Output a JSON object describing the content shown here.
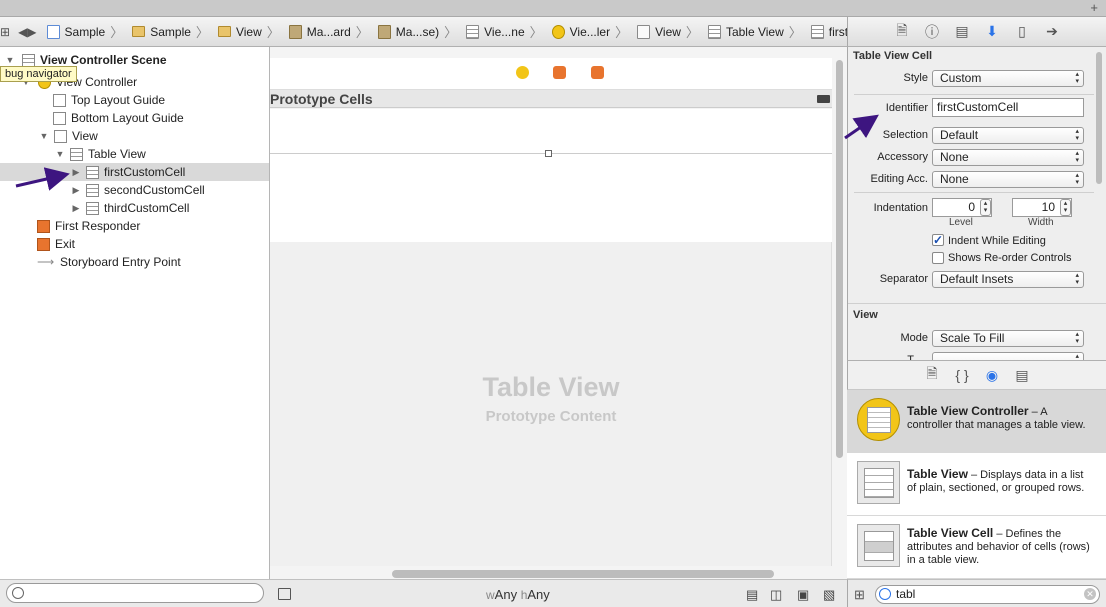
{
  "toolbar": {
    "plus": "+"
  },
  "jumpbar": {
    "grid": "⊞",
    "back": "◀",
    "forward": "▶",
    "crumbs": [
      "Sample",
      "Sample",
      "View",
      "Ma...ard",
      "Ma...se)",
      "Vie...ne",
      "Vie...ler",
      "View",
      "Table View",
      "firstCustomCell"
    ],
    "separator": "〉"
  },
  "inspector_tabs": [
    "file",
    "help",
    "identity",
    "attributes",
    "size",
    "connections"
  ],
  "navigator": {
    "tooltip": "bug navigator",
    "items": [
      {
        "label": "View Controller Scene"
      },
      {
        "label": "View Controller"
      },
      {
        "label": "Top Layout Guide"
      },
      {
        "label": "Bottom Layout Guide"
      },
      {
        "label": "View"
      },
      {
        "label": "Table View"
      },
      {
        "label": "firstCustomCell"
      },
      {
        "label": "secondCustomCell"
      },
      {
        "label": "thirdCustomCell"
      },
      {
        "label": "First Responder"
      },
      {
        "label": "Exit"
      },
      {
        "label": "Storyboard Entry Point"
      }
    ]
  },
  "canvas": {
    "section_header": "Prototype Cells",
    "placeholder_title": "Table View",
    "placeholder_subtitle": "Prototype Content",
    "size_class": {
      "w_prefix": "w",
      "w_value": "Any",
      "h_prefix": "h",
      "h_value": "Any"
    }
  },
  "inspector": {
    "section1": "Table View Cell",
    "style_label": "Style",
    "style_value": "Custom",
    "identifier_label": "Identifier",
    "identifier_value": "firstCustomCell",
    "selection_label": "Selection",
    "selection_value": "Default",
    "accessory_label": "Accessory",
    "accessory_value": "None",
    "editing_label": "Editing Acc.",
    "editing_value": "None",
    "indentation_label": "Indentation",
    "level_value": "0",
    "level_label": "Level",
    "width_value": "10",
    "width_label": "Width",
    "indent_while_editing": "Indent While Editing",
    "indent_while_editing_checked": true,
    "shows_reorder": "Shows Re-order Controls",
    "shows_reorder_checked": false,
    "separator_label": "Separator",
    "separator_value": "Default Insets",
    "section2": "View",
    "mode_label": "Mode",
    "mode_value": "Scale To Fill",
    "partial_label": "T"
  },
  "library": {
    "tabs": [
      "file-template",
      "code-snippet",
      "object-library",
      "media-library"
    ],
    "items": [
      {
        "title": "Table View Controller",
        "desc": " – A controller that manages a table view."
      },
      {
        "title": "Table View",
        "desc": " – Displays data in a list of plain, sectioned, or grouped rows."
      },
      {
        "title": "Table View Cell",
        "desc": " – Defines the attributes and behavior of cells (rows) in a table view."
      }
    ],
    "search_value": "tabl"
  },
  "colors": {
    "annotation_arrow": "#3d1580",
    "accent": "#2a73e8",
    "vc_yellow": "#f2c518"
  }
}
